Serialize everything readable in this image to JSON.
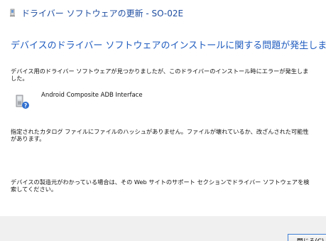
{
  "window": {
    "title": "ドライバー ソフトウェアの更新 - SO-02E"
  },
  "main": {
    "heading": "デバイスのドライバー ソフトウェアのインストールに関する問題が発生しました。",
    "paragraph1": "デバイス用のドライバー ソフトウェアが見つかりましたが、このドライバーのインストール時にエラーが発生しました。",
    "device_name": "Android Composite ADB Interface",
    "device_icon": "device-question-icon",
    "paragraph2": "指定されたカタログ ファイルにファイルのハッシュがありません。ファイルが壊れているか、改ざんされた可能性があります。",
    "paragraph3": "デバイスの製造元がわかっている場合は、その Web サイトのサポート セクションでドライバー ソフトウェアを検索してください。"
  },
  "footer": {
    "close_label": "閉じる(C)"
  }
}
